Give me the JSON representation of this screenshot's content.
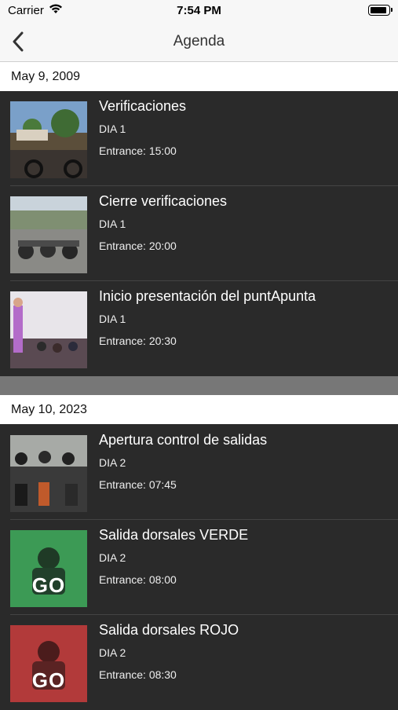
{
  "status": {
    "carrier": "Carrier",
    "time": "7:54 PM"
  },
  "nav": {
    "title": "Agenda"
  },
  "sections": [
    {
      "header": "May 9, 2009",
      "items": [
        {
          "title": "Verificaciones",
          "sub": "DIA 1",
          "entrance": "Entrance: 15:00"
        },
        {
          "title": "Cierre verificaciones",
          "sub": "DIA 1",
          "entrance": "Entrance: 20:00"
        },
        {
          "title": "Inicio presentación del puntApunta",
          "sub": "DIA 1",
          "entrance": "Entrance: 20:30"
        }
      ]
    },
    {
      "header": "May 10, 2023",
      "items": [
        {
          "title": "Apertura control de salidas",
          "sub": "DIA 2",
          "entrance": "Entrance: 07:45"
        },
        {
          "title": "Salida dorsales VERDE",
          "sub": "DIA 2",
          "entrance": "Entrance: 08:00",
          "badge": "GO"
        },
        {
          "title": "Salida dorsales ROJO",
          "sub": "DIA 2",
          "entrance": "Entrance: 08:30",
          "badge": "GO"
        }
      ]
    }
  ],
  "colors": {
    "background": "#2a2a2a",
    "header_bg": "#ffffff",
    "nav_bg": "#f7f7f7",
    "green_thumb": "#3c9a55",
    "red_thumb": "#b23a3a"
  }
}
